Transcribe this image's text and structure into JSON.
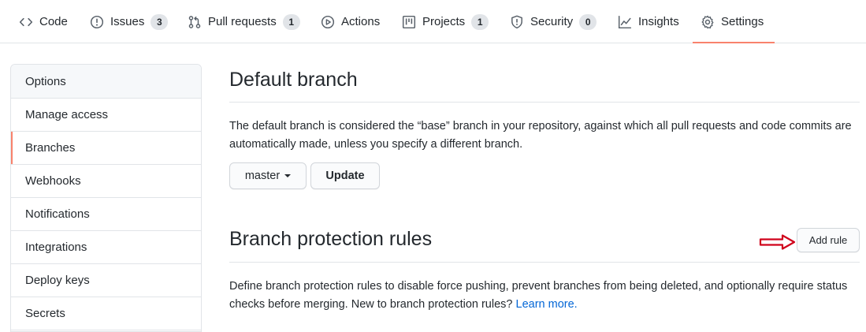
{
  "nav": {
    "tabs": [
      {
        "label": "Code",
        "icon": "code-icon"
      },
      {
        "label": "Issues",
        "icon": "issue-opened-icon",
        "count": "3"
      },
      {
        "label": "Pull requests",
        "icon": "git-pull-request-icon",
        "count": "1"
      },
      {
        "label": "Actions",
        "icon": "play-icon"
      },
      {
        "label": "Projects",
        "icon": "project-icon",
        "count": "1"
      },
      {
        "label": "Security",
        "icon": "shield-icon",
        "count": "0"
      },
      {
        "label": "Insights",
        "icon": "graph-icon"
      },
      {
        "label": "Settings",
        "icon": "gear-icon",
        "selected": true
      }
    ]
  },
  "sidebar": {
    "items": [
      {
        "label": "Options"
      },
      {
        "label": "Manage access"
      },
      {
        "label": "Branches",
        "selected": true
      },
      {
        "label": "Webhooks"
      },
      {
        "label": "Notifications"
      },
      {
        "label": "Integrations"
      },
      {
        "label": "Deploy keys"
      },
      {
        "label": "Secrets"
      }
    ]
  },
  "default_branch": {
    "title": "Default branch",
    "description": "The default branch is considered the “base” branch in your repository, against which all pull requests and code commits are automatically made, unless you specify a different branch.",
    "branch_select_label": "master",
    "update_label": "Update"
  },
  "protection": {
    "title": "Branch protection rules",
    "add_rule_label": "Add rule",
    "description": "Define branch protection rules to disable force pushing, prevent branches from being deleted, and optionally require status checks before merging. New to branch protection rules?",
    "learn_more": "Learn more."
  },
  "colors": {
    "accent_underline": "#f9826c",
    "link": "#0366d6",
    "annotation_arrow": "#d0021b"
  }
}
